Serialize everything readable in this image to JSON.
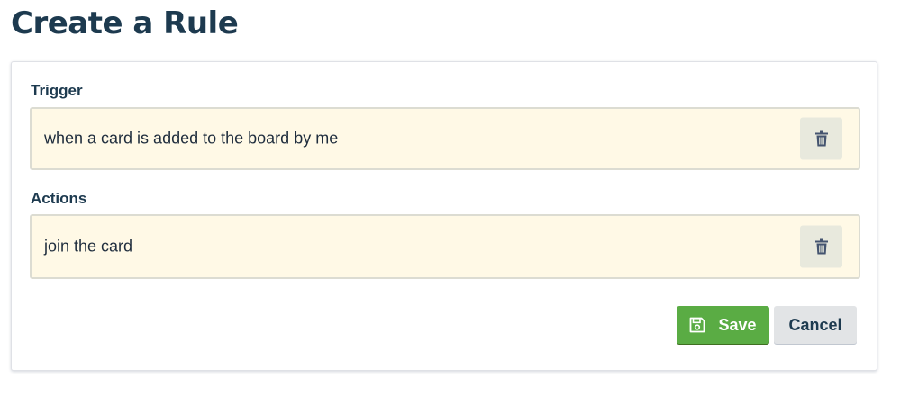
{
  "page": {
    "title": "Create a Rule"
  },
  "trigger": {
    "heading": "Trigger",
    "text": "when a card is added to the board by me",
    "delete_icon": "trash-icon"
  },
  "actions": {
    "heading": "Actions",
    "items": [
      {
        "text": "join the card",
        "delete_icon": "trash-icon"
      }
    ]
  },
  "footer": {
    "save_label": "Save",
    "save_icon": "floppy-disk-icon",
    "cancel_label": "Cancel"
  },
  "colors": {
    "title": "#1d3a4f",
    "item_background": "#fff9e6",
    "save_button": "#5aac44",
    "cancel_button": "#e2e4e6"
  }
}
